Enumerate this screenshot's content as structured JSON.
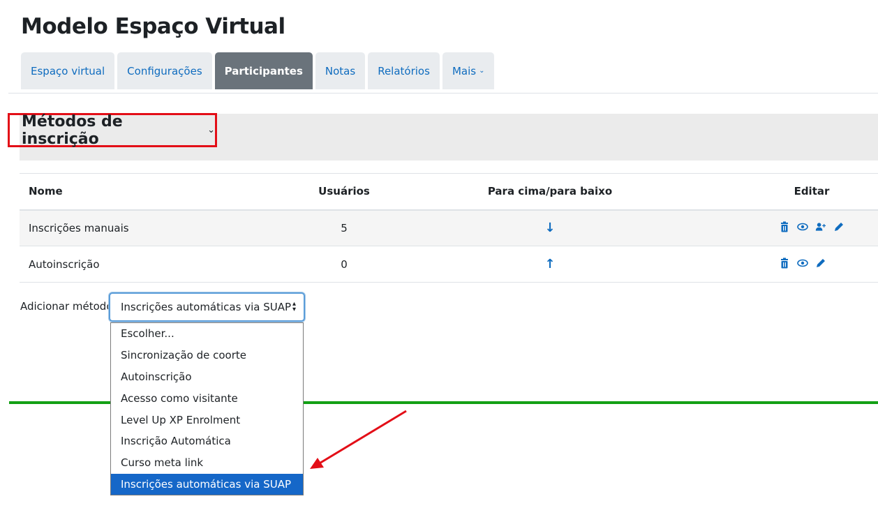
{
  "page": {
    "title": "Modelo Espaço Virtual"
  },
  "tabs": [
    {
      "label": "Espaço virtual"
    },
    {
      "label": "Configurações"
    },
    {
      "label": "Participantes"
    },
    {
      "label": "Notas"
    },
    {
      "label": "Relatórios"
    },
    {
      "label": "Mais"
    }
  ],
  "section": {
    "title": "Métodos de inscrição"
  },
  "table": {
    "headers": [
      "Nome",
      "Usuários",
      "Para cima/para baixo",
      "Editar"
    ],
    "rows": [
      {
        "name": "Inscrições manuais",
        "users": "5"
      },
      {
        "name": "Autoinscrição",
        "users": "0"
      }
    ]
  },
  "add_method": {
    "label": "Adicionar método",
    "selected": "Inscrições automáticas via SUAP",
    "options": [
      "Escolher...",
      "Sincronização de coorte",
      "Autoinscrição",
      "Acesso como visitante",
      "Level Up XP Enrolment",
      "Inscrição Automática",
      "Curso meta link",
      "Inscrições automáticas via SUAP"
    ]
  },
  "colors": {
    "accent": "#0f6cbf",
    "highlight_box": "#e30e17",
    "active_tab": "#6a737b",
    "selected_option": "#1567c8",
    "divider": "#13a015"
  },
  "icons": [
    "chevron-down-icon",
    "arrow-down-icon",
    "arrow-up-icon",
    "trash-icon",
    "eye-icon",
    "user-plus-icon",
    "pencil-icon",
    "select-updown-icon",
    "annotation-arrow-icon"
  ]
}
